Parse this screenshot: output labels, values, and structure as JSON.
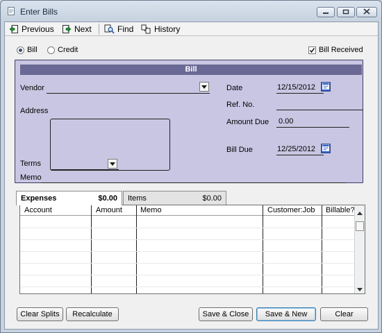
{
  "window": {
    "title": "Enter Bills"
  },
  "toolbar": {
    "previous": "Previous",
    "next": "Next",
    "find": "Find",
    "history": "History"
  },
  "type_options": {
    "bill": "Bill",
    "credit": "Credit",
    "selected": "Bill",
    "bill_received_label": "Bill Received",
    "bill_received_checked": true
  },
  "form": {
    "header": "Bill",
    "vendor_label": "Vendor",
    "vendor_value": "",
    "address_label": "Address",
    "terms_label": "Terms",
    "terms_value": "",
    "memo_label": "Memo",
    "memo_value": "",
    "date_label": "Date",
    "date_value": "12/15/2012",
    "ref_label": "Ref. No.",
    "ref_value": "",
    "amount_due_label": "Amount Due",
    "amount_due_value": "0.00",
    "bill_due_label": "Bill Due",
    "bill_due_value": "12/25/2012"
  },
  "tabs": [
    {
      "label": "Expenses",
      "amount": "$0.00",
      "active": true
    },
    {
      "label": "Items",
      "amount": "$0.00",
      "active": false
    }
  ],
  "grid": {
    "columns": [
      "Account",
      "Amount",
      "Memo",
      "Customer:Job",
      "Billable?"
    ],
    "rows": []
  },
  "buttons": {
    "clear_splits": "Clear Splits",
    "recalculate": "Recalculate",
    "save_close": "Save & Close",
    "save_new": "Save & New",
    "clear": "Clear"
  },
  "colors": {
    "form_bg": "#c8c6e2",
    "form_header": "#6a6894",
    "window_chrome": "#c9d3df"
  }
}
